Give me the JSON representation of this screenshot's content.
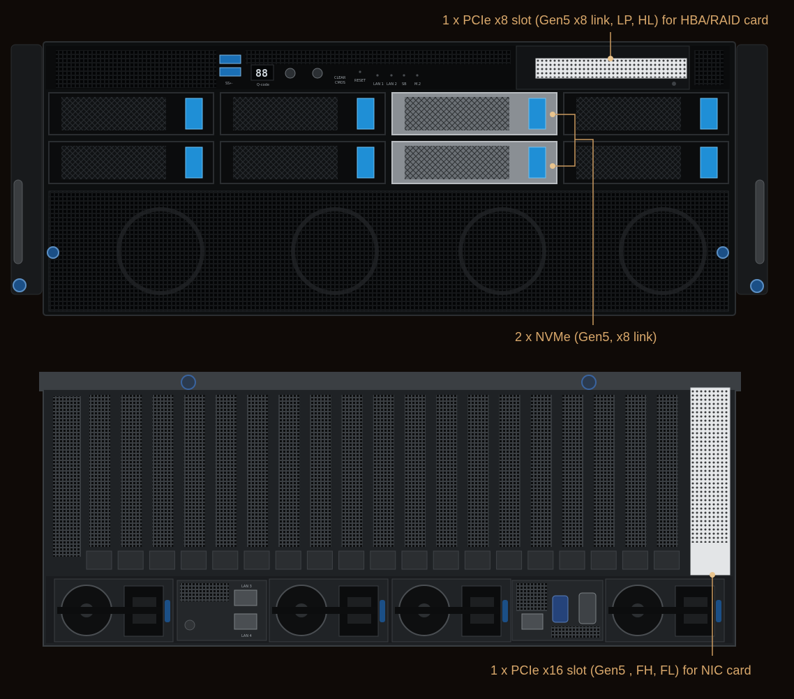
{
  "callouts": {
    "hba_raid": "1 x PCIe x8 slot (Gen5 x8 link, LP, HL) for HBA/RAID card",
    "nvme": "2 x NVMe (Gen5, x8 link)",
    "nic": "1 x PCIe x16 slot (Gen5 , FH, FL) for NIC card"
  },
  "front_panel": {
    "usb_label": "SS⇠",
    "qcode_display": "88",
    "qcode_label": "Q-code",
    "clear_cmos_line1": "CLEAR",
    "clear_cmos_line2": "CMOS",
    "reset_label": "RESET",
    "led_labels": [
      "LAN 1",
      "LAN 2",
      "SB",
      "M.2"
    ]
  },
  "rear_panel": {
    "lan_top_label": "LAN 3",
    "lan_bottom_label": "LAN 4"
  },
  "colors": {
    "background": "#0f0a07",
    "callout_text": "#d9a86b",
    "leader_line": "#c9995f",
    "drive_latch_blue": "#1f8fd6",
    "chassis_dark": "#141618",
    "chassis_rear": "#2a2d30"
  }
}
